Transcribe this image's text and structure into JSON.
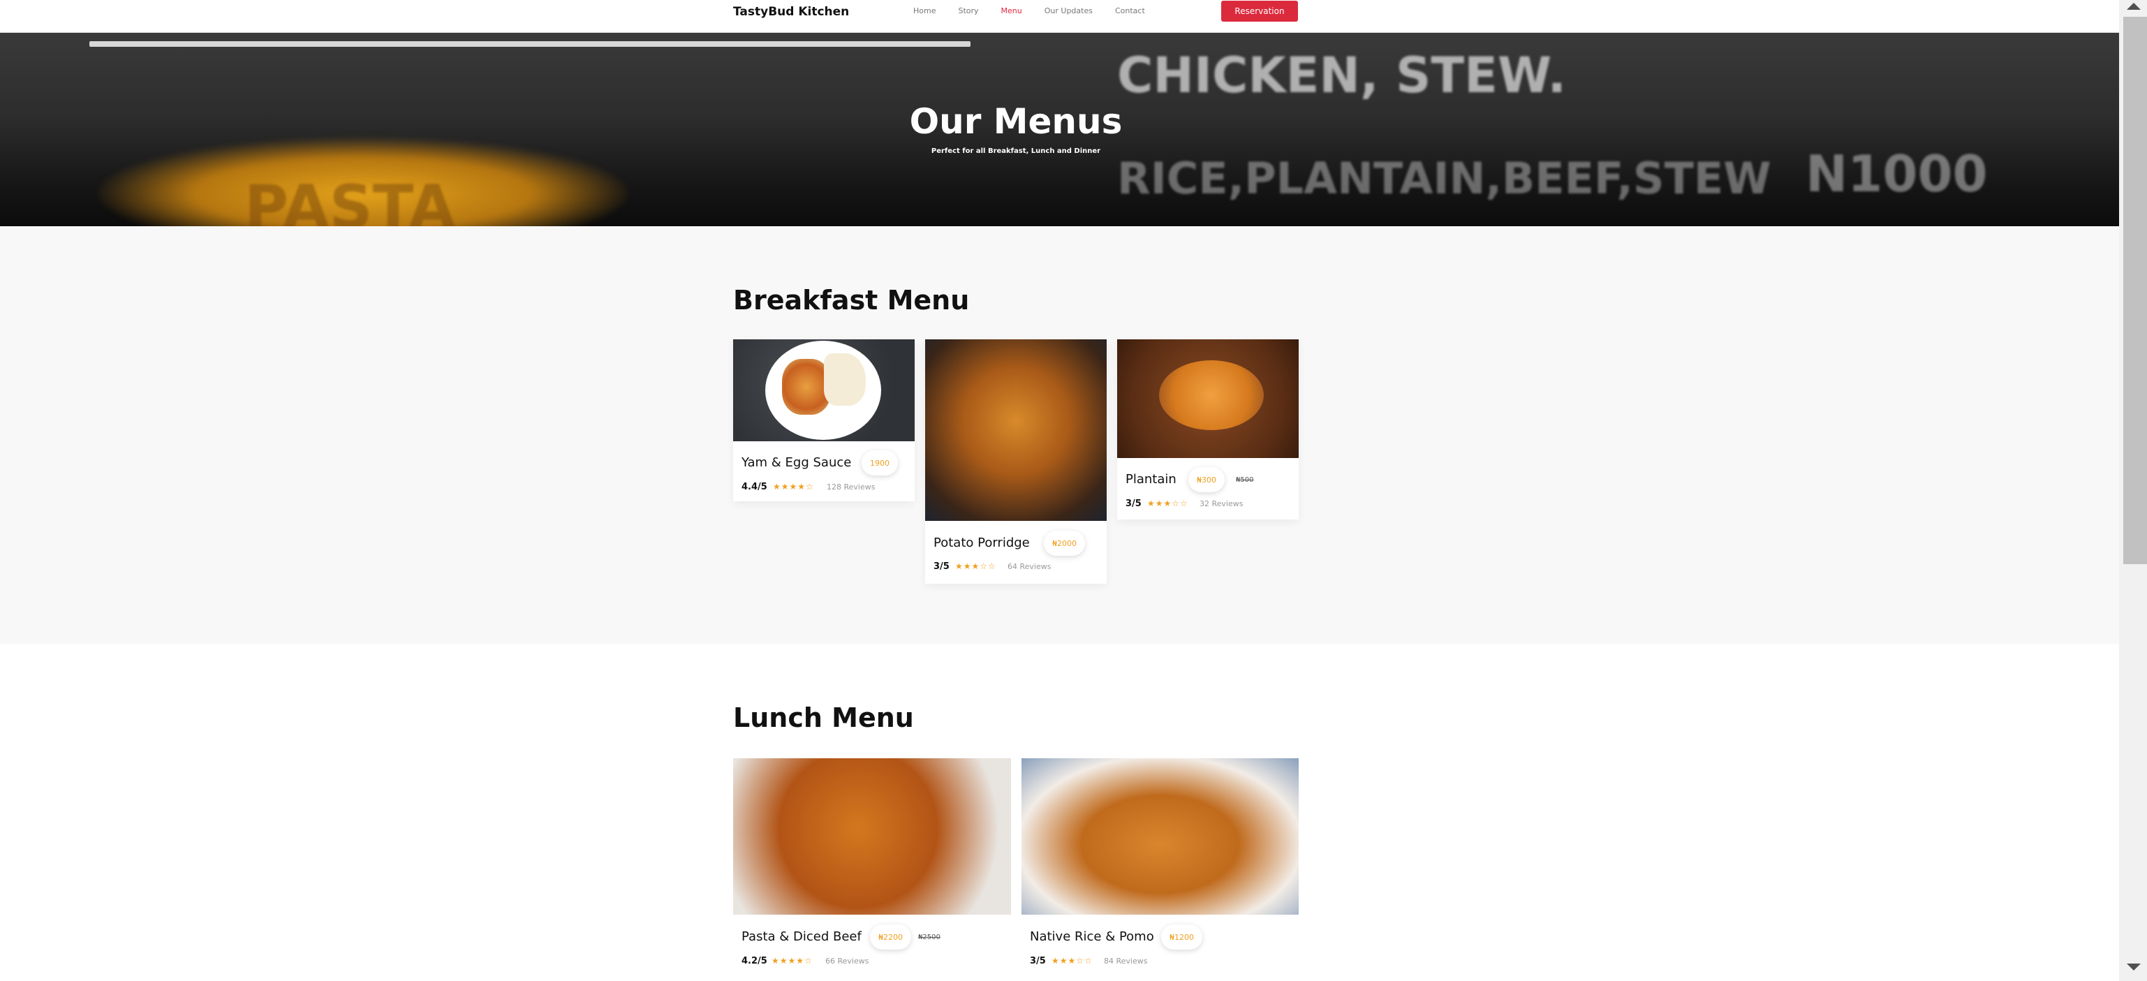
{
  "nav": {
    "brand": "TastyBud Kitchen",
    "links": [
      "Home",
      "Story",
      "Menu",
      "Our Updates",
      "Contact"
    ],
    "active": "Menu",
    "reservation": "Reservation"
  },
  "hero": {
    "title": "Our Menus",
    "subtitle": "Perfect for all Breakfast, Lunch and Dinner",
    "background_text": [
      "CHICKEN, STEW.",
      "RICE,PLANTAIN,BEEF,STEW",
      "N1000",
      "PASTA"
    ]
  },
  "breakfast": {
    "title": "Breakfast Menu",
    "items": [
      {
        "name": "Yam & Egg Sauce",
        "price": "1900",
        "old_price": "",
        "rating": "4.4/5",
        "stars": "★★★★☆",
        "reviews": "128 Reviews"
      },
      {
        "name": "Potato Porridge",
        "price": "₦2000",
        "old_price": "",
        "rating": "3/5",
        "stars": "★★★☆☆",
        "reviews": "64 Reviews"
      },
      {
        "name": "Plantain",
        "price": "₦300",
        "old_price": "₦500",
        "rating": "3/5",
        "stars": "★★★☆☆",
        "reviews": "32 Reviews"
      }
    ]
  },
  "lunch": {
    "title": "Lunch Menu",
    "items": [
      {
        "name": "Pasta & Diced Beef",
        "price": "₦2200",
        "old_price": "₦2500",
        "rating": "4.2/5",
        "stars": "★★★★☆",
        "reviews": "66 Reviews"
      },
      {
        "name": "Native Rice & Pomo",
        "price": "₦1200",
        "old_price": "",
        "rating": "3/5",
        "stars": "★★★☆☆",
        "reviews": "84 Reviews"
      }
    ]
  },
  "colors": {
    "accent": "#dc2a3d",
    "price": "#f0a020"
  }
}
